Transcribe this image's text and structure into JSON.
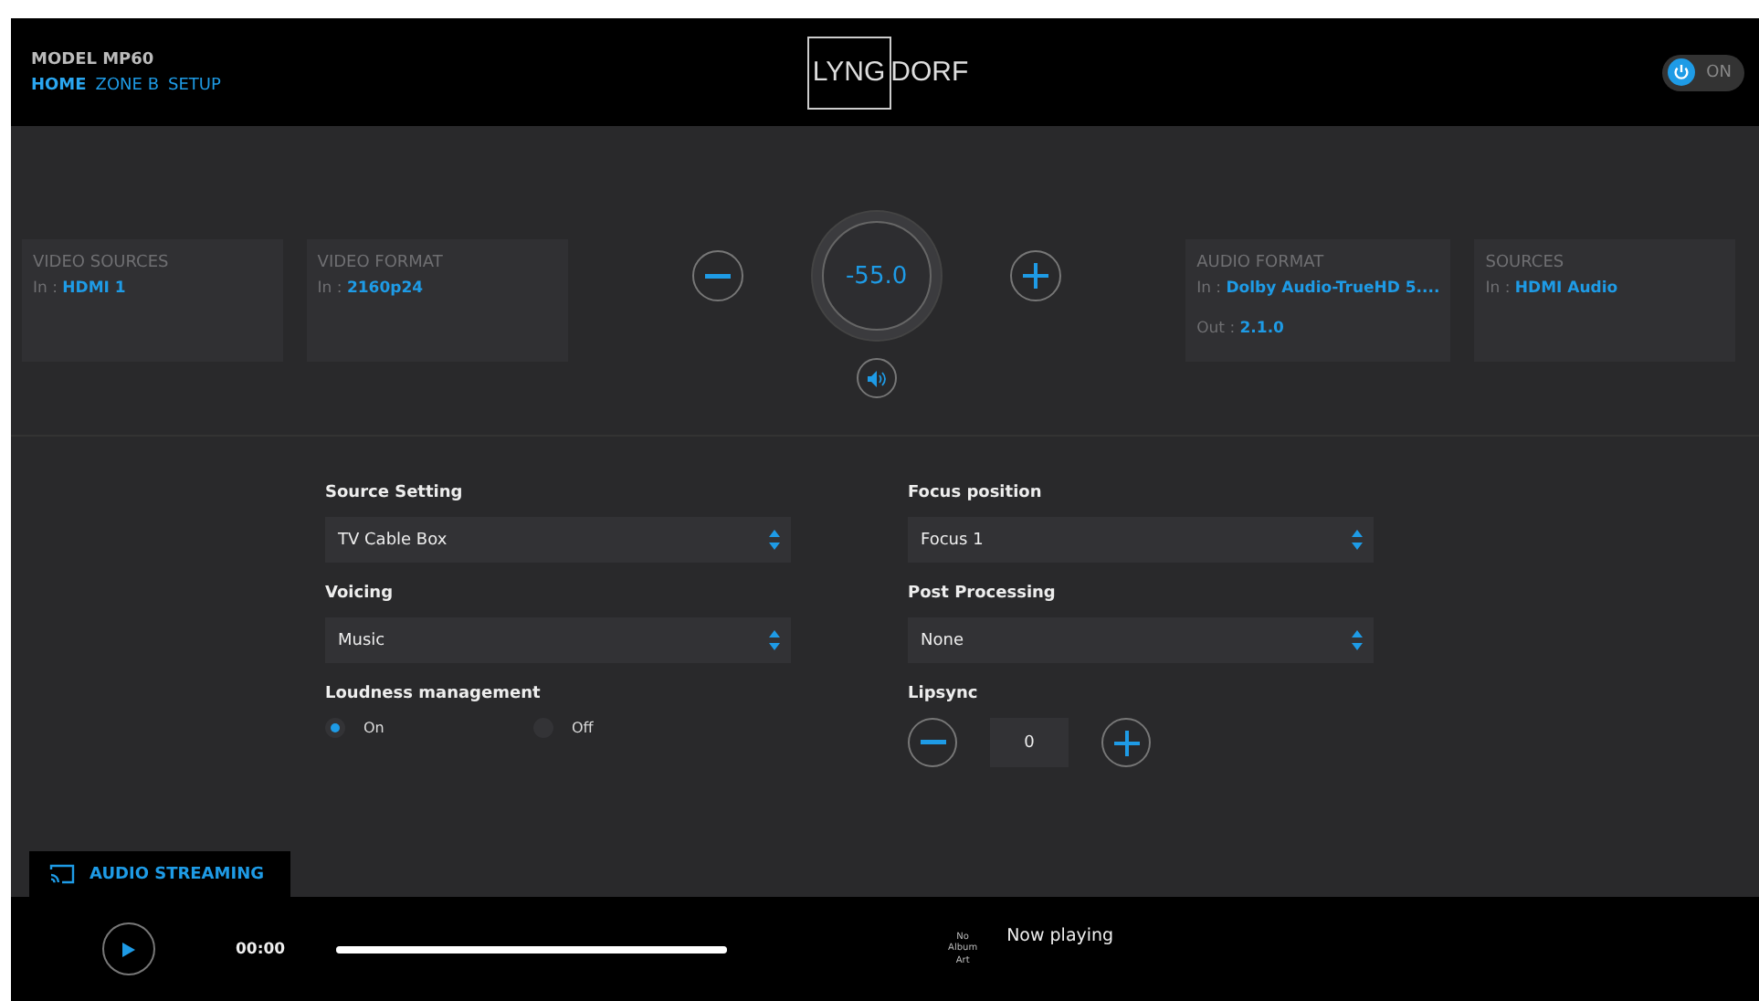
{
  "header": {
    "model": "MODEL MP60",
    "nav": [
      {
        "label": "HOME",
        "selected": true
      },
      {
        "label": "ZONE B",
        "selected": false
      },
      {
        "label": "SETUP",
        "selected": false
      }
    ],
    "logo": {
      "boxed": "LYNG",
      "rest": "DORF"
    },
    "power": {
      "label": "ON",
      "on": true
    }
  },
  "cards_left": [
    {
      "title": "VIDEO SOURCES",
      "lines": [
        {
          "prefix": "In : ",
          "value": "HDMI 1"
        }
      ]
    },
    {
      "title": "VIDEO FORMAT",
      "lines": [
        {
          "prefix": "In : ",
          "value": "2160p24"
        }
      ]
    }
  ],
  "volume": {
    "value": "-55.0",
    "muted": false
  },
  "cards_right": [
    {
      "title": "AUDIO FORMAT",
      "lines": [
        {
          "prefix": "In : ",
          "value": "Dolby Audio-TrueHD 5...."
        },
        {
          "prefix": "Out : ",
          "value": "2.1.0"
        }
      ]
    },
    {
      "title": "SOURCES",
      "lines": [
        {
          "prefix": "In : ",
          "value": "HDMI Audio"
        }
      ]
    }
  ],
  "settings_left": [
    {
      "kind": "select",
      "label": "Source Setting",
      "value": "TV Cable Box"
    },
    {
      "kind": "select",
      "label": "Voicing",
      "value": "Music"
    },
    {
      "kind": "radio",
      "label": "Loudness management",
      "options": [
        {
          "label": "On",
          "selected": true
        },
        {
          "label": "Off",
          "selected": false
        }
      ]
    }
  ],
  "settings_right": [
    {
      "kind": "select",
      "label": "Focus position",
      "value": "Focus 1"
    },
    {
      "kind": "select",
      "label": "Post Processing",
      "value": "None"
    },
    {
      "kind": "stepper",
      "label": "Lipsync",
      "value": "0"
    }
  ],
  "streaming_tab": {
    "label": "AUDIO STREAMING"
  },
  "player": {
    "time": "00:00",
    "level": 1,
    "album_art": "No Album Art",
    "now_playing": "Now playing"
  }
}
